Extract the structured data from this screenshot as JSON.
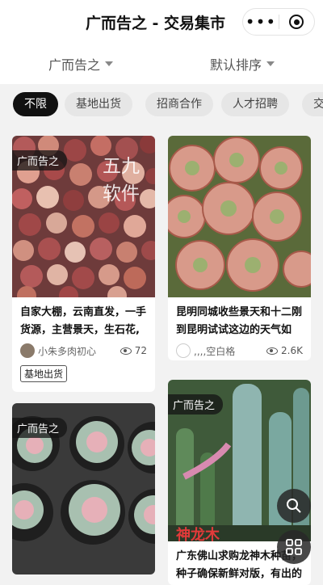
{
  "header": {
    "title": "广而告之 - 交易集市",
    "more_glyph": "•••"
  },
  "filters": {
    "category": "广而告之",
    "sort": "默认排序"
  },
  "chips": [
    "不限",
    "基地出货",
    "招商合作",
    "人才招聘",
    "交"
  ],
  "cards": [
    {
      "tag": "广而告之",
      "title": "自家大棚，云南直发，一手货源，主营景天，生石花,",
      "author": "小朱多肉初心",
      "views": "72",
      "label": "基地出货"
    },
    {
      "tag": "广而告之",
      "title": "昆明同城收些景天和十二刚到昆明试试这边的天气如",
      "author": ",,,,空白格",
      "views": "2.6K"
    },
    {
      "tag": "广而告之"
    },
    {
      "tag": "广而告之",
      "title": "广东佛山求购龙神木种苗，种子确保新鲜对版，有出的"
    }
  ],
  "watermarks": {
    "card1": "五九软件",
    "card4": "神龙木"
  }
}
